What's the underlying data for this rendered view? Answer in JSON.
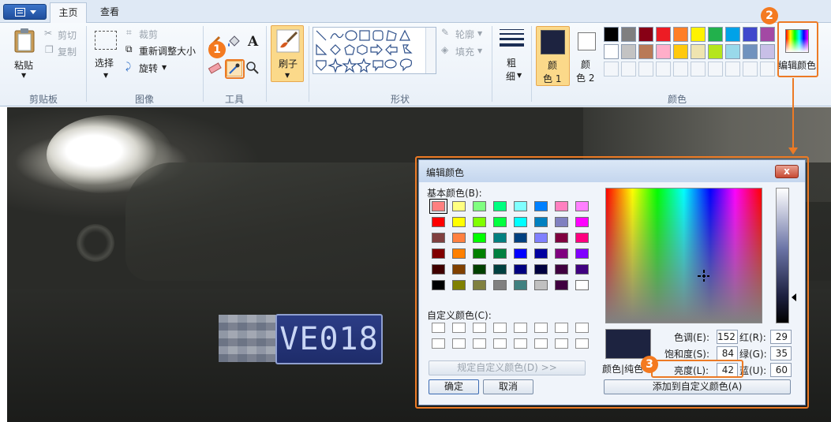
{
  "tabs": {
    "home": "主页",
    "view": "查看"
  },
  "ribbon": {
    "clipboard": {
      "paste": "粘贴",
      "cut": "剪切",
      "copy": "复制",
      "label": "剪贴板"
    },
    "image": {
      "select": "选择",
      "crop": "裁剪",
      "resize": "重新调整大小",
      "rotate": "旋转",
      "label": "图像"
    },
    "tools": {
      "text_glyph": "A",
      "label": "工具"
    },
    "brush": {
      "label": "刷子"
    },
    "shapes": {
      "outline": "轮廓",
      "fill": "填充",
      "label": "形状"
    },
    "size": {
      "line1": "粗",
      "line2": "细"
    },
    "colors": {
      "color1_line1": "颜",
      "color1_line2": "色 1",
      "color2_line1": "颜",
      "color2_line2": "色 2",
      "edit_colors": "编辑颜色",
      "label": "颜色",
      "color1_value": "#1d2340",
      "palette_row1": [
        "#000000",
        "#7f7f7f",
        "#880015",
        "#ed1c24",
        "#ff7f27",
        "#fff200",
        "#22b14c",
        "#00a2e8",
        "#3f48cc",
        "#a349a4"
      ],
      "palette_row2": [
        "#ffffff",
        "#c3c3c3",
        "#b97a57",
        "#ffaec9",
        "#ffc90e",
        "#efe4b0",
        "#b5e61d",
        "#99d9ea",
        "#7092be",
        "#c8bfe7"
      ]
    }
  },
  "markers": {
    "m1": "1",
    "m2": "2",
    "m3": "3"
  },
  "photo": {
    "plate_text": "VE018"
  },
  "dialog": {
    "title": "编辑颜色",
    "close_glyph": "x",
    "basic_colors_label": "基本颜色(B):",
    "custom_colors_label": "自定义颜色(C):",
    "define_custom_button": "规定自定义颜色(D) >>",
    "ok_button": "确定",
    "cancel_button": "取消",
    "color_solid_label": "颜色|纯色",
    "add_custom_button": "添加到自定义颜色(A)",
    "hue_label": "色调(E):",
    "hue_value": "152",
    "sat_label": "饱和度(S):",
    "sat_value": "84",
    "lum_label": "亮度(L):",
    "lum_value": "42",
    "red_label": "红(R):",
    "red_value": "29",
    "green_label": "绿(G):",
    "green_value": "35",
    "blue_label": "蓝(U):",
    "blue_value": "60",
    "basic_colors": [
      [
        "#ff8080",
        "#ffff80",
        "#80ff80",
        "#00ff80",
        "#80ffff",
        "#0080ff",
        "#ff80c0",
        "#ff80ff"
      ],
      [
        "#ff0000",
        "#ffff00",
        "#80ff00",
        "#00ff40",
        "#00ffff",
        "#0080c0",
        "#8080c0",
        "#ff00ff"
      ],
      [
        "#804040",
        "#ff8040",
        "#00ff00",
        "#008080",
        "#004080",
        "#8080ff",
        "#800040",
        "#ff0080"
      ],
      [
        "#800000",
        "#ff8000",
        "#008000",
        "#008040",
        "#0000ff",
        "#0000a0",
        "#800080",
        "#8000ff"
      ],
      [
        "#400000",
        "#804000",
        "#004000",
        "#004040",
        "#000080",
        "#000040",
        "#400040",
        "#400080"
      ],
      [
        "#000000",
        "#808000",
        "#808040",
        "#808080",
        "#408080",
        "#c0c0c0",
        "#400040",
        "#ffffff"
      ]
    ]
  }
}
